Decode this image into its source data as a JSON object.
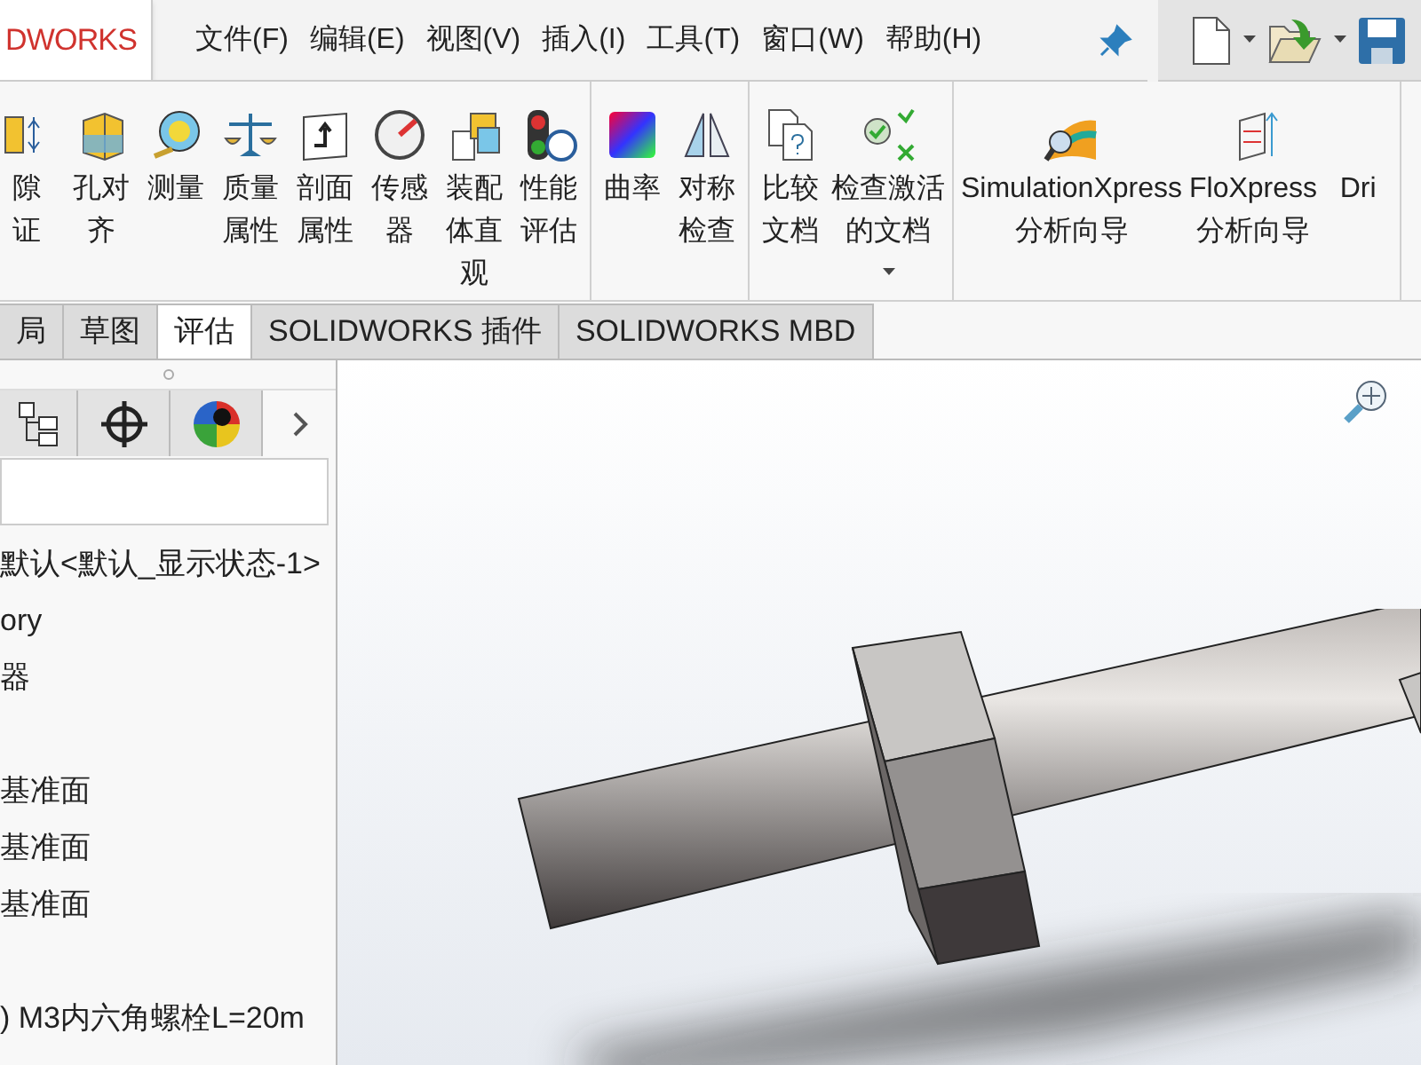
{
  "logo": {
    "text": "DWORKS"
  },
  "menu": [
    "文件(F)",
    "编辑(E)",
    "视图(V)",
    "插入(I)",
    "工具(T)",
    "窗口(W)",
    "帮助(H)"
  ],
  "ribbon": {
    "groups": [
      {
        "items": [
          {
            "lines": [
              "隙",
              "证"
            ]
          },
          {
            "lines": [
              "孔对",
              "齐"
            ]
          },
          {
            "lines": [
              "测量"
            ]
          },
          {
            "lines": [
              "质量",
              "属性"
            ]
          },
          {
            "lines": [
              "剖面",
              "属性"
            ]
          },
          {
            "lines": [
              "传感",
              "器"
            ]
          },
          {
            "lines": [
              "装配",
              "体直",
              "观"
            ]
          },
          {
            "lines": [
              "性能",
              "评估"
            ]
          }
        ]
      },
      {
        "items": [
          {
            "lines": [
              "曲率"
            ]
          },
          {
            "lines": [
              "对称",
              "检查"
            ]
          }
        ]
      },
      {
        "items": [
          {
            "lines": [
              "比较",
              "文档"
            ]
          },
          {
            "lines": [
              "检查激活",
              "的文档"
            ],
            "dropdown": true
          }
        ]
      },
      {
        "items": [
          {
            "lines": [
              "SimulationXpress",
              "分析向导"
            ]
          },
          {
            "lines": [
              "FloXpress",
              "分析向导"
            ]
          },
          {
            "lines": [
              "Dri"
            ]
          }
        ]
      }
    ]
  },
  "tabs": [
    {
      "label": "局",
      "selected": false
    },
    {
      "label": "草图",
      "selected": false
    },
    {
      "label": "评估",
      "selected": true
    },
    {
      "label": "SOLIDWORKS 插件",
      "selected": false
    },
    {
      "label": "SOLIDWORKS MBD",
      "selected": false
    }
  ],
  "tree": {
    "items": [
      {
        "label": "默认<默认_显示状态-1>"
      },
      {
        "label": "ory"
      },
      {
        "label": "器"
      },
      {
        "label": "基准面",
        "gap_before": true
      },
      {
        "label": "基准面"
      },
      {
        "label": "基准面"
      },
      {
        "label": ") M3内六角螺栓L=20m",
        "gap_before": true
      }
    ]
  }
}
